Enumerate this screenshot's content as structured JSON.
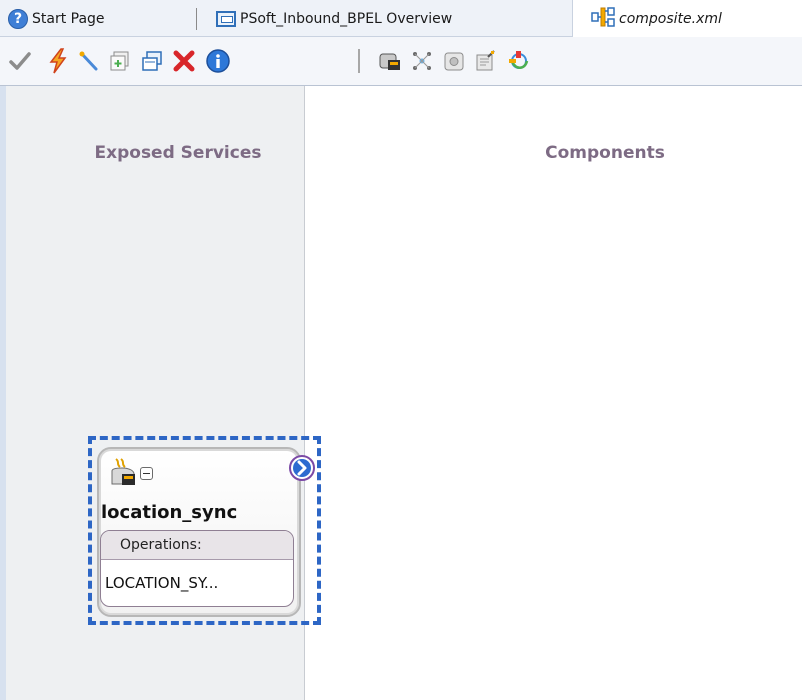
{
  "tabs": [
    {
      "label": "Start Page",
      "icon": "help-icon"
    },
    {
      "label": "PSoft_Inbound_BPEL Overview",
      "icon": "overview-icon"
    },
    {
      "label": "composite.xml",
      "icon": "composite-icon",
      "active": true
    }
  ],
  "toolbar": {
    "buttons": [
      "validate-check-icon",
      "lightning-icon",
      "wire-pen-icon",
      "add-page-icon",
      "copy-page-icon",
      "delete-x-icon",
      "info-icon",
      "adapter-icon",
      "mediator-icon",
      "database-icon",
      "document-edit-icon",
      "deploy-icon"
    ]
  },
  "canvas": {
    "left_heading": "Exposed Services",
    "right_heading": "Components"
  },
  "service": {
    "name": "location_sync",
    "operations_label": "Operations:",
    "operation": "LOCATION_SY..."
  },
  "colors": {
    "heading": "#7d6b84",
    "selection": "#2d66c5",
    "tab_bar": "#eef2f8",
    "left_panel": "#eef0f2"
  }
}
